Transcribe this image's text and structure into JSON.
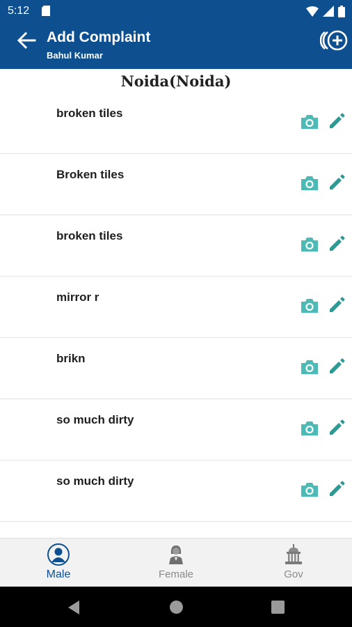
{
  "status_bar": {
    "time": "5:12"
  },
  "app_bar": {
    "title": "Add Complaint",
    "subtitle": "Bahul Kumar"
  },
  "location": {
    "title": "Noida(Noida)"
  },
  "complaints": [
    {
      "text": "broken tiles"
    },
    {
      "text": "Broken tiles"
    },
    {
      "text": "broken tiles"
    },
    {
      "text": "mirror r"
    },
    {
      "text": "brikn"
    },
    {
      "text": "so much dirty"
    },
    {
      "text": "so much dirty"
    },
    {
      "text": "-"
    }
  ],
  "bottom_nav": {
    "male_label": "Male",
    "female_label": "Female",
    "gov_label": "Gov",
    "active": "Male"
  },
  "colors": {
    "primary": "#0d4f8f",
    "accent": "#3fb2b0",
    "camera": "#4dbab6",
    "edit": "#2f9a94"
  },
  "icons": {
    "back": "arrow-left-icon",
    "add": "add-circle-icon",
    "camera": "camera-icon",
    "edit": "pencil-icon",
    "male": "male-user-icon",
    "female": "female-user-icon",
    "gov": "government-building-icon"
  }
}
